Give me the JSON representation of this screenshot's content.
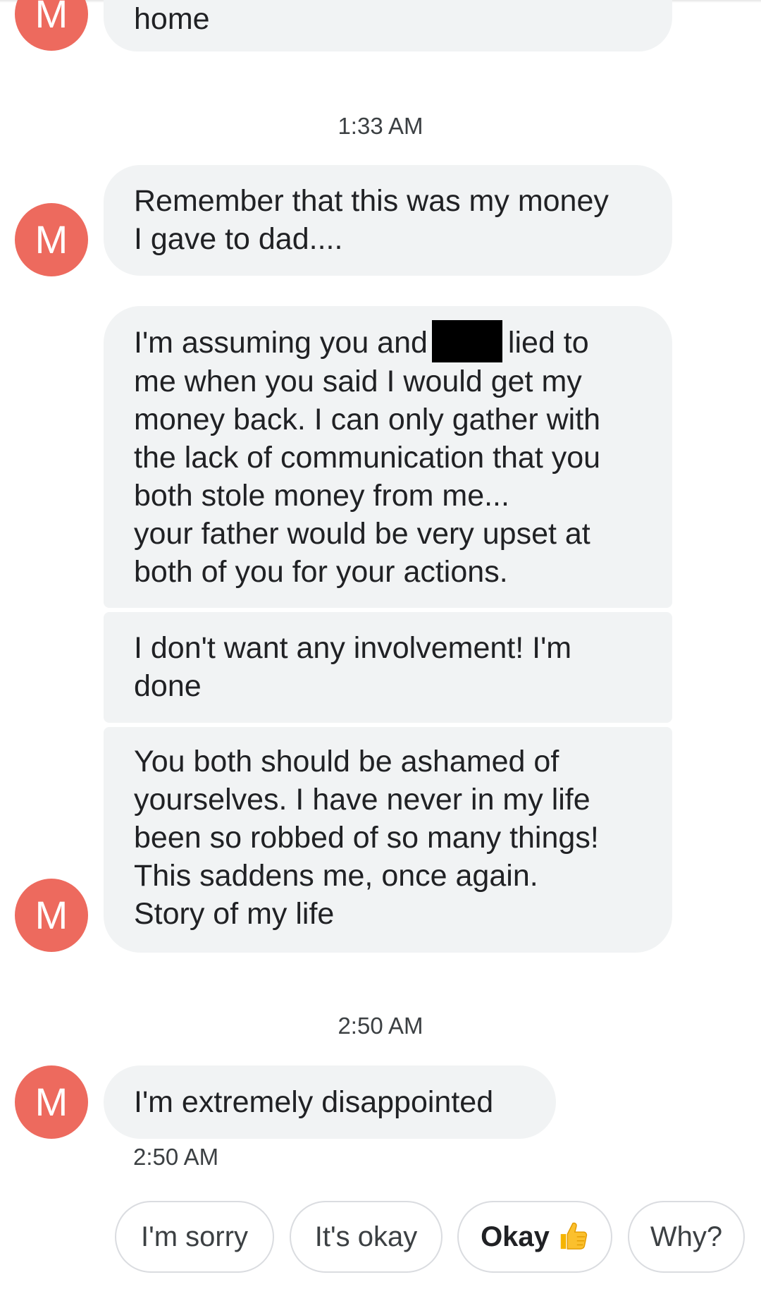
{
  "conversation": {
    "avatar_letter": "M",
    "avatar_color": "#ed6a5e",
    "bubble_color": "#f1f3f4",
    "top_partial_message": "home",
    "groups": [
      {
        "timestamp": "1:33 AM",
        "messages": [
          {
            "text": "Remember that this was my money\nI gave to dad...."
          },
          {
            "line1_before": "I'm assuming you and",
            "line1_after": "lied to",
            "text_rest": "me when you said I would get my\nmoney back. I can only gather with\nthe lack of communication that you\nboth stole money from me...\nyour father would be very upset at\nboth of you for your actions."
          },
          {
            "text": "I don't want any involvement! I'm\ndone"
          },
          {
            "text": "You both should be ashamed of\nyourselves. I have never in my life\nbeen so robbed of so many things!\nThis saddens me, once again.\nStory of my life"
          }
        ]
      },
      {
        "timestamp": "2:50 AM",
        "messages": [
          {
            "text": "I'm extremely disappointed",
            "time": "2:50 AM"
          }
        ]
      }
    ]
  },
  "smart_replies": [
    {
      "label": "I'm sorry"
    },
    {
      "label": "It's okay"
    },
    {
      "label": "Okay",
      "icon": "thumbs-up-icon"
    },
    {
      "label": "Why?"
    }
  ]
}
